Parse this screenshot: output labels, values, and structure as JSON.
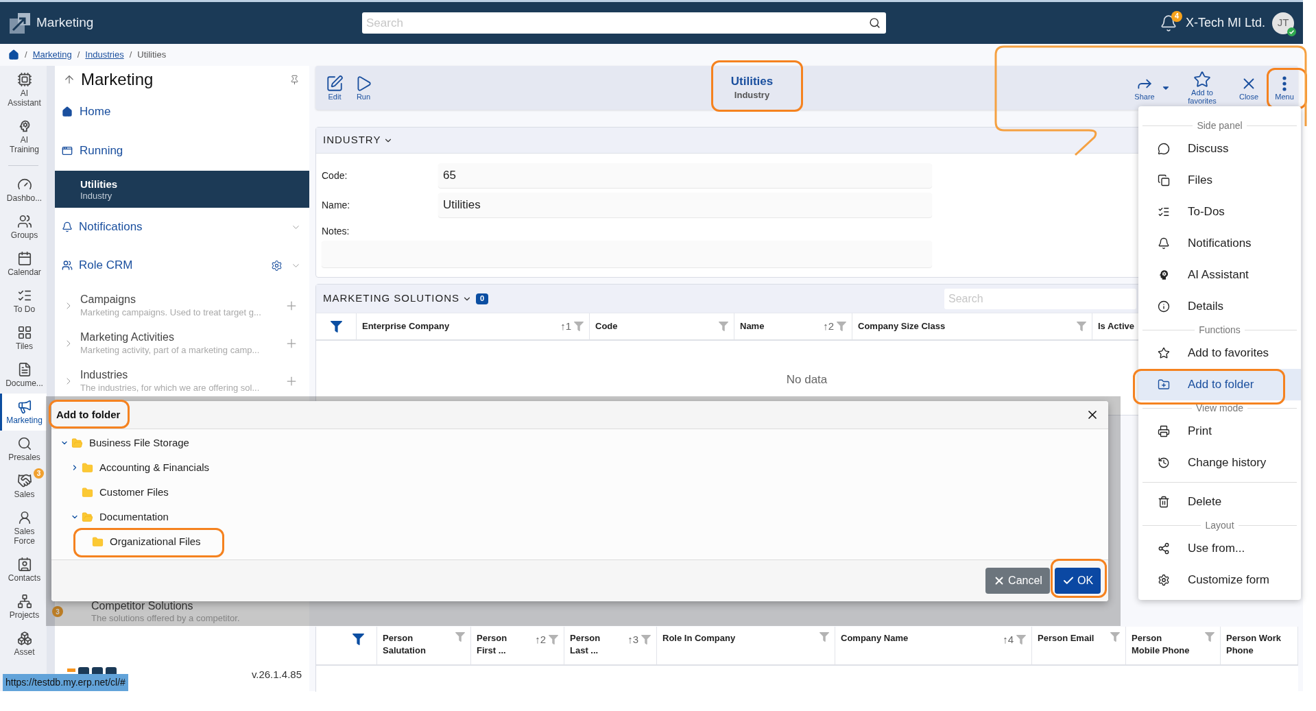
{
  "app_bar": {
    "title": "Marketing",
    "search": {
      "placeholder": "Search"
    },
    "notification_count": "4",
    "company": "X-Tech MI Ltd.",
    "avatar": {
      "initials": "JT",
      "online": true
    }
  },
  "breadcrumb": {
    "separator": "/",
    "items": [
      {
        "label": "Marketing",
        "link": true
      },
      {
        "label": "Industries",
        "link": true
      },
      {
        "label": "Utilities",
        "link": false
      }
    ]
  },
  "rail": {
    "top": [
      {
        "label": "AI Assistant",
        "selected": false
      },
      {
        "label": "AI Training",
        "selected": false
      }
    ],
    "main": [
      {
        "label": "Dashbo...",
        "selected": false
      },
      {
        "label": "Groups",
        "selected": false
      },
      {
        "label": "Calendar",
        "selected": false
      },
      {
        "label": "To Do",
        "selected": false
      },
      {
        "label": "Tiles",
        "selected": false
      },
      {
        "label": "Docume...",
        "selected": false
      },
      {
        "label": "Marketing",
        "selected": true
      },
      {
        "label": "Presales",
        "selected": false
      },
      {
        "label": "Sales",
        "selected": false,
        "badge": "3"
      },
      {
        "label": "Sales Force",
        "selected": false
      },
      {
        "label": "Contacts",
        "selected": false
      },
      {
        "label": "Projects",
        "selected": false
      },
      {
        "label": "Asset",
        "selected": false
      }
    ]
  },
  "nav": {
    "title": "Marketing",
    "links": [
      {
        "label": "Home"
      },
      {
        "label": "Running"
      }
    ],
    "running": [
      {
        "title": "Utilities",
        "subtitle": "Industry",
        "selected": true
      }
    ],
    "groups": [
      {
        "label": "Notifications",
        "settings": false
      },
      {
        "label": "Role CRM",
        "settings": true
      }
    ],
    "entries": [
      {
        "title": "Campaigns",
        "description": "Marketing campaigns. Used to treat target g..."
      },
      {
        "title": "Marketing Activities",
        "description": "Marketing activity, part of a marketing camp..."
      },
      {
        "title": "Industries",
        "description": "The industries, for which we are offering sol..."
      }
    ],
    "entries_below": [
      {
        "title": "Competitor Solutions",
        "description": "The solutions offered by a competitor.",
        "badge": "3"
      }
    ],
    "version": "v.26.1.4.85"
  },
  "toolbar": {
    "actions_left": [
      {
        "label": "Edit"
      },
      {
        "label": "Run"
      }
    ],
    "title": "Utilities",
    "subtitle": "Industry",
    "title_highlighted": true,
    "actions_right": [
      {
        "label": "Share",
        "dropdown": true,
        "highlighted": false
      },
      {
        "label": "Add to favorites",
        "dropdown": false,
        "highlighted": false
      },
      {
        "label": "Close",
        "dropdown": false,
        "highlighted": false
      },
      {
        "label": "Menu",
        "dropdown": false,
        "highlighted": true
      }
    ]
  },
  "industry_section": {
    "title": "INDUSTRY",
    "fields": [
      {
        "label": "Code:",
        "value": "65",
        "kind": "input"
      },
      {
        "label": "Name:",
        "value": "Utilities",
        "kind": "input"
      },
      {
        "label": "Notes:",
        "kind": "textarea"
      }
    ]
  },
  "marketing_solutions": {
    "title": "MARKETING SOLUTIONS",
    "count": "0",
    "search": {
      "placeholder": "Search"
    },
    "columns": [
      {
        "label": "Enterprise Company",
        "sort": "↑1",
        "filter": true
      },
      {
        "label": "Code",
        "filter": true
      },
      {
        "label": "Name",
        "sort": "↑2",
        "filter": true
      },
      {
        "label": "Company Size Class",
        "filter": true
      },
      {
        "label": "Is Active",
        "filter": false
      }
    ],
    "empty_text": "No data"
  },
  "related_table": {
    "columns": [
      {
        "label": "Person Salutation",
        "filter": true
      },
      {
        "label": "Person First ...",
        "sort": "↑2",
        "filter": true
      },
      {
        "label": "Person Last ...",
        "sort": "↑3",
        "filter": true
      },
      {
        "label": "Role In Company",
        "filter": true
      },
      {
        "label": "Company Name",
        "sort": "↑4",
        "filter": true
      },
      {
        "label": "Person Email",
        "filter": true
      },
      {
        "label": "Person Mobile Phone",
        "filter": true
      },
      {
        "label": "Person Work Phone",
        "filter": false
      }
    ]
  },
  "menu": {
    "groups": [
      {
        "title": "Side panel",
        "items": [
          {
            "label": "Discuss",
            "selected": false,
            "highlighted": false
          },
          {
            "label": "Files",
            "selected": false,
            "highlighted": false
          },
          {
            "label": "To-Dos",
            "selected": false,
            "highlighted": false
          },
          {
            "label": "Notifications",
            "selected": false,
            "highlighted": false
          },
          {
            "label": "AI Assistant",
            "selected": false,
            "highlighted": false
          },
          {
            "label": "Details",
            "selected": false,
            "highlighted": false
          }
        ]
      },
      {
        "title": "Functions",
        "items": [
          {
            "label": "Add to favorites",
            "selected": false,
            "highlighted": false
          },
          {
            "label": "Add to folder",
            "selected": true,
            "highlighted": true
          }
        ]
      },
      {
        "title": "View mode",
        "items": [
          {
            "label": "Print",
            "selected": false,
            "highlighted": false
          },
          {
            "label": "Change history",
            "selected": false,
            "highlighted": false
          }
        ]
      },
      {
        "items": [
          {
            "label": "Delete",
            "selected": false,
            "highlighted": false
          }
        ]
      },
      {
        "title": "Layout",
        "items": [
          {
            "label": "Use from...",
            "selected": false,
            "highlighted": false
          },
          {
            "label": "Customize form",
            "selected": false,
            "highlighted": false
          }
        ]
      }
    ]
  },
  "dialog": {
    "title": "Add to folder",
    "title_highlighted": true,
    "tree": [
      {
        "label": "Business File Storage",
        "expanded": true,
        "highlighted": false,
        "children": [
          {
            "label": "Accounting & Financials",
            "expanded": false,
            "highlighted": false
          },
          {
            "label": "Customer Files",
            "highlighted": false
          },
          {
            "label": "Documentation",
            "expanded": true,
            "highlighted": false,
            "children": [
              {
                "label": "Organizational Files",
                "highlighted": true
              }
            ]
          }
        ]
      }
    ],
    "buttons": [
      {
        "label": "Cancel",
        "kind": "secondary",
        "highlighted": false
      },
      {
        "label": "OK",
        "kind": "primary",
        "highlighted": true
      }
    ]
  },
  "status_url": "https://testdb.my.erp.net/cl/#"
}
